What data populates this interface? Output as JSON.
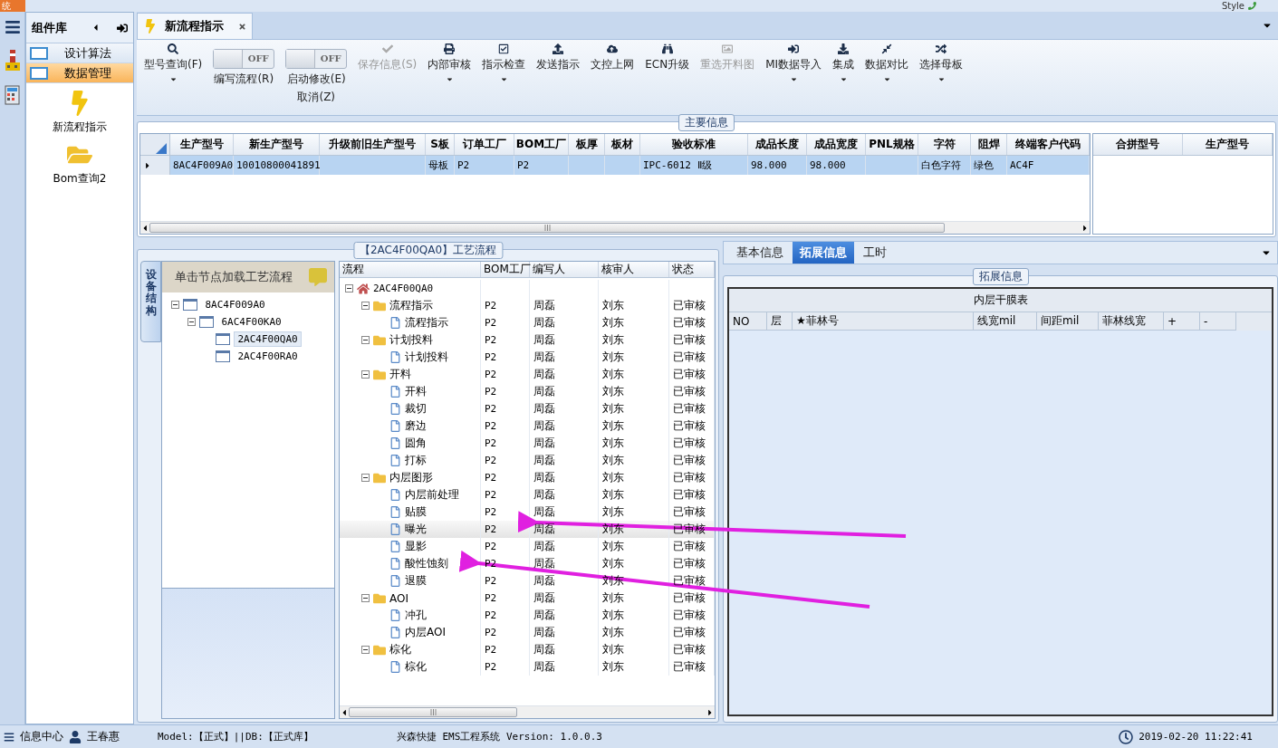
{
  "app_title": "统",
  "style_menu": "Style",
  "library": {
    "title": "组件库",
    "categories": [
      {
        "label": "设计算法",
        "selected": false
      },
      {
        "label": "数据管理",
        "selected": true
      }
    ],
    "items": [
      {
        "label": "新流程指示",
        "kind": "lightning"
      },
      {
        "label": "Bom查询2",
        "kind": "folder"
      }
    ]
  },
  "doc_tabs": [
    {
      "label": "新流程指示",
      "selected": true
    }
  ],
  "toolbar": [
    {
      "kind": "button",
      "label": "型号查询(F)",
      "dropdown": true,
      "disabled": false
    },
    {
      "kind": "toggle",
      "label": "编写流程(R)",
      "toggle_text": "OFF",
      "on": false
    },
    {
      "kind": "toggle",
      "label": "启动修改(E)",
      "second_line": "取消(Z)",
      "toggle_text": "OFF",
      "on": false
    },
    {
      "kind": "button",
      "label": "保存信息(S)",
      "dropdown": false,
      "disabled": true
    },
    {
      "kind": "button",
      "label": "内部审核",
      "dropdown": true,
      "disabled": false
    },
    {
      "kind": "button",
      "label": "指示检查",
      "dropdown": true,
      "disabled": false
    },
    {
      "kind": "button",
      "label": "发送指示",
      "dropdown": false,
      "disabled": false
    },
    {
      "kind": "button",
      "label": "文控上网",
      "dropdown": false,
      "disabled": false
    },
    {
      "kind": "button",
      "label": "ECN升级",
      "dropdown": false,
      "disabled": false
    },
    {
      "kind": "button",
      "label": "重选开料图",
      "dropdown": false,
      "disabled": true
    },
    {
      "kind": "button",
      "label": "MI数据导入",
      "dropdown": true,
      "disabled": false
    },
    {
      "kind": "button",
      "label": "集成",
      "dropdown": true,
      "disabled": false
    },
    {
      "kind": "button",
      "label": "数据对比",
      "dropdown": true,
      "disabled": false
    },
    {
      "kind": "button",
      "label": "选择母板",
      "dropdown": true,
      "disabled": false
    }
  ],
  "main_info": {
    "title": "主要信息",
    "columns": [
      "生产型号",
      "新生产型号",
      "升级前旧生产型号",
      "S板",
      "订单工厂",
      "BOM工厂",
      "板厚",
      "板材",
      "验收标准",
      "成品长度",
      "成品宽度",
      "PNL规格",
      "字符",
      "阻焊",
      "终端客户代码"
    ],
    "rows": [
      {
        "selected": true,
        "cells": [
          "8AC4F009A0",
          "10010800041891",
          null,
          "母板",
          "P2",
          "P2",
          null,
          null,
          "IPC-6012 Ⅱ级",
          "98.000",
          "98.000",
          null,
          "白色字符",
          "绿色",
          "AC4F"
        ]
      }
    ]
  },
  "side_table": {
    "columns": [
      "合拼型号",
      "生产型号"
    ]
  },
  "process": {
    "title": "【2AC4F00QA0】工艺流程",
    "side_tab": "设备结构",
    "device_header": "单击节点加载工艺流程",
    "devices": [
      {
        "name": "8AC4F009A0",
        "selected": false,
        "expanded": true,
        "children": [
          {
            "name": "6AC4F00KA0",
            "selected": false,
            "expanded": true,
            "children": [
              {
                "name": "2AC4F00QA0",
                "selected": true
              },
              {
                "name": "2AC4F00RA0",
                "selected": false
              }
            ]
          }
        ]
      }
    ],
    "columns": [
      "流程",
      "BOM工厂",
      "编写人",
      "核审人",
      "状态"
    ],
    "tree": [
      {
        "name": "2AC4F00QA0",
        "kind": "root",
        "selected": false,
        "expanded": true,
        "children": [
          {
            "name": "流程指示",
            "kind": "folder",
            "factory": "P2",
            "writer": "周磊",
            "reviewer": "刘东",
            "status": "已审核",
            "selected": false,
            "expanded": true,
            "children": [
              {
                "name": "流程指示",
                "kind": "step",
                "factory": "P2",
                "writer": "周磊",
                "reviewer": "刘东",
                "status": "已审核",
                "selected": false
              }
            ]
          },
          {
            "name": "计划投料",
            "kind": "folder",
            "factory": "P2",
            "writer": "周磊",
            "reviewer": "刘东",
            "status": "已审核",
            "selected": false,
            "expanded": true,
            "children": [
              {
                "name": "计划投料",
                "kind": "step",
                "factory": "P2",
                "writer": "周磊",
                "reviewer": "刘东",
                "status": "已审核",
                "selected": false
              }
            ]
          },
          {
            "name": "开料",
            "kind": "folder",
            "factory": "P2",
            "writer": "周磊",
            "reviewer": "刘东",
            "status": "已审核",
            "selected": false,
            "expanded": true,
            "children": [
              {
                "name": "开料",
                "kind": "step",
                "factory": "P2",
                "writer": "周磊",
                "reviewer": "刘东",
                "status": "已审核",
                "selected": false
              },
              {
                "name": "裁切",
                "kind": "step",
                "factory": "P2",
                "writer": "周磊",
                "reviewer": "刘东",
                "status": "已审核",
                "selected": false
              },
              {
                "name": "磨边",
                "kind": "step",
                "factory": "P2",
                "writer": "周磊",
                "reviewer": "刘东",
                "status": "已审核",
                "selected": false
              },
              {
                "name": "圆角",
                "kind": "step",
                "factory": "P2",
                "writer": "周磊",
                "reviewer": "刘东",
                "status": "已审核",
                "selected": false
              },
              {
                "name": "打标",
                "kind": "step",
                "factory": "P2",
                "writer": "周磊",
                "reviewer": "刘东",
                "status": "已审核",
                "selected": false
              }
            ]
          },
          {
            "name": "内层图形",
            "kind": "folder",
            "factory": "P2",
            "writer": "周磊",
            "reviewer": "刘东",
            "status": "已审核",
            "selected": false,
            "expanded": true,
            "children": [
              {
                "name": "内层前处理",
                "kind": "step",
                "factory": "P2",
                "writer": "周磊",
                "reviewer": "刘东",
                "status": "已审核",
                "selected": false
              },
              {
                "name": "贴膜",
                "kind": "step",
                "factory": "P2",
                "writer": "周磊",
                "reviewer": "刘东",
                "status": "已审核",
                "selected": false
              },
              {
                "name": "曝光",
                "kind": "step",
                "factory": "P2",
                "writer": "周磊",
                "reviewer": "刘东",
                "status": "已审核",
                "selected": true
              },
              {
                "name": "显影",
                "kind": "step",
                "factory": "P2",
                "writer": "周磊",
                "reviewer": "刘东",
                "status": "已审核",
                "selected": false
              },
              {
                "name": "酸性蚀刻",
                "kind": "step",
                "factory": "P2",
                "writer": "周磊",
                "reviewer": "刘东",
                "status": "已审核",
                "selected": false
              },
              {
                "name": "退膜",
                "kind": "step",
                "factory": "P2",
                "writer": "周磊",
                "reviewer": "刘东",
                "status": "已审核",
                "selected": false
              }
            ]
          },
          {
            "name": "AOI",
            "kind": "folder",
            "factory": "P2",
            "writer": "周磊",
            "reviewer": "刘东",
            "status": "已审核",
            "selected": false,
            "expanded": true,
            "children": [
              {
                "name": "冲孔",
                "kind": "step",
                "factory": "P2",
                "writer": "周磊",
                "reviewer": "刘东",
                "status": "已审核",
                "selected": false
              },
              {
                "name": "内层AOI",
                "kind": "step",
                "factory": "P2",
                "writer": "周磊",
                "reviewer": "刘东",
                "status": "已审核",
                "selected": false
              }
            ]
          },
          {
            "name": "棕化",
            "kind": "folder",
            "factory": "P2",
            "writer": "周磊",
            "reviewer": "刘东",
            "status": "已审核",
            "selected": false,
            "expanded": true,
            "children": [
              {
                "name": "棕化",
                "kind": "step",
                "factory": "P2",
                "writer": "周磊",
                "reviewer": "刘东",
                "status": "已审核",
                "selected": false
              }
            ]
          }
        ]
      }
    ]
  },
  "ext": {
    "tabs": [
      {
        "label": "基本信息",
        "selected": false
      },
      {
        "label": "拓展信息",
        "selected": true
      },
      {
        "label": "工时",
        "selected": false
      }
    ],
    "group_title": "拓展信息",
    "table_title": "内层干膜表",
    "columns": [
      "NO",
      "层",
      "★菲林号",
      "线宽mil",
      "间距mil",
      "菲林线宽",
      "+",
      "-"
    ]
  },
  "status_bar": {
    "info_center": "信息中心",
    "user": "王春惠",
    "env": "Model:【正式】||DB:【正式库】",
    "product": "兴森快捷 EMS工程系统 Version: 1.0.0.3",
    "datetime": "2019-02-20 11:22:41"
  }
}
